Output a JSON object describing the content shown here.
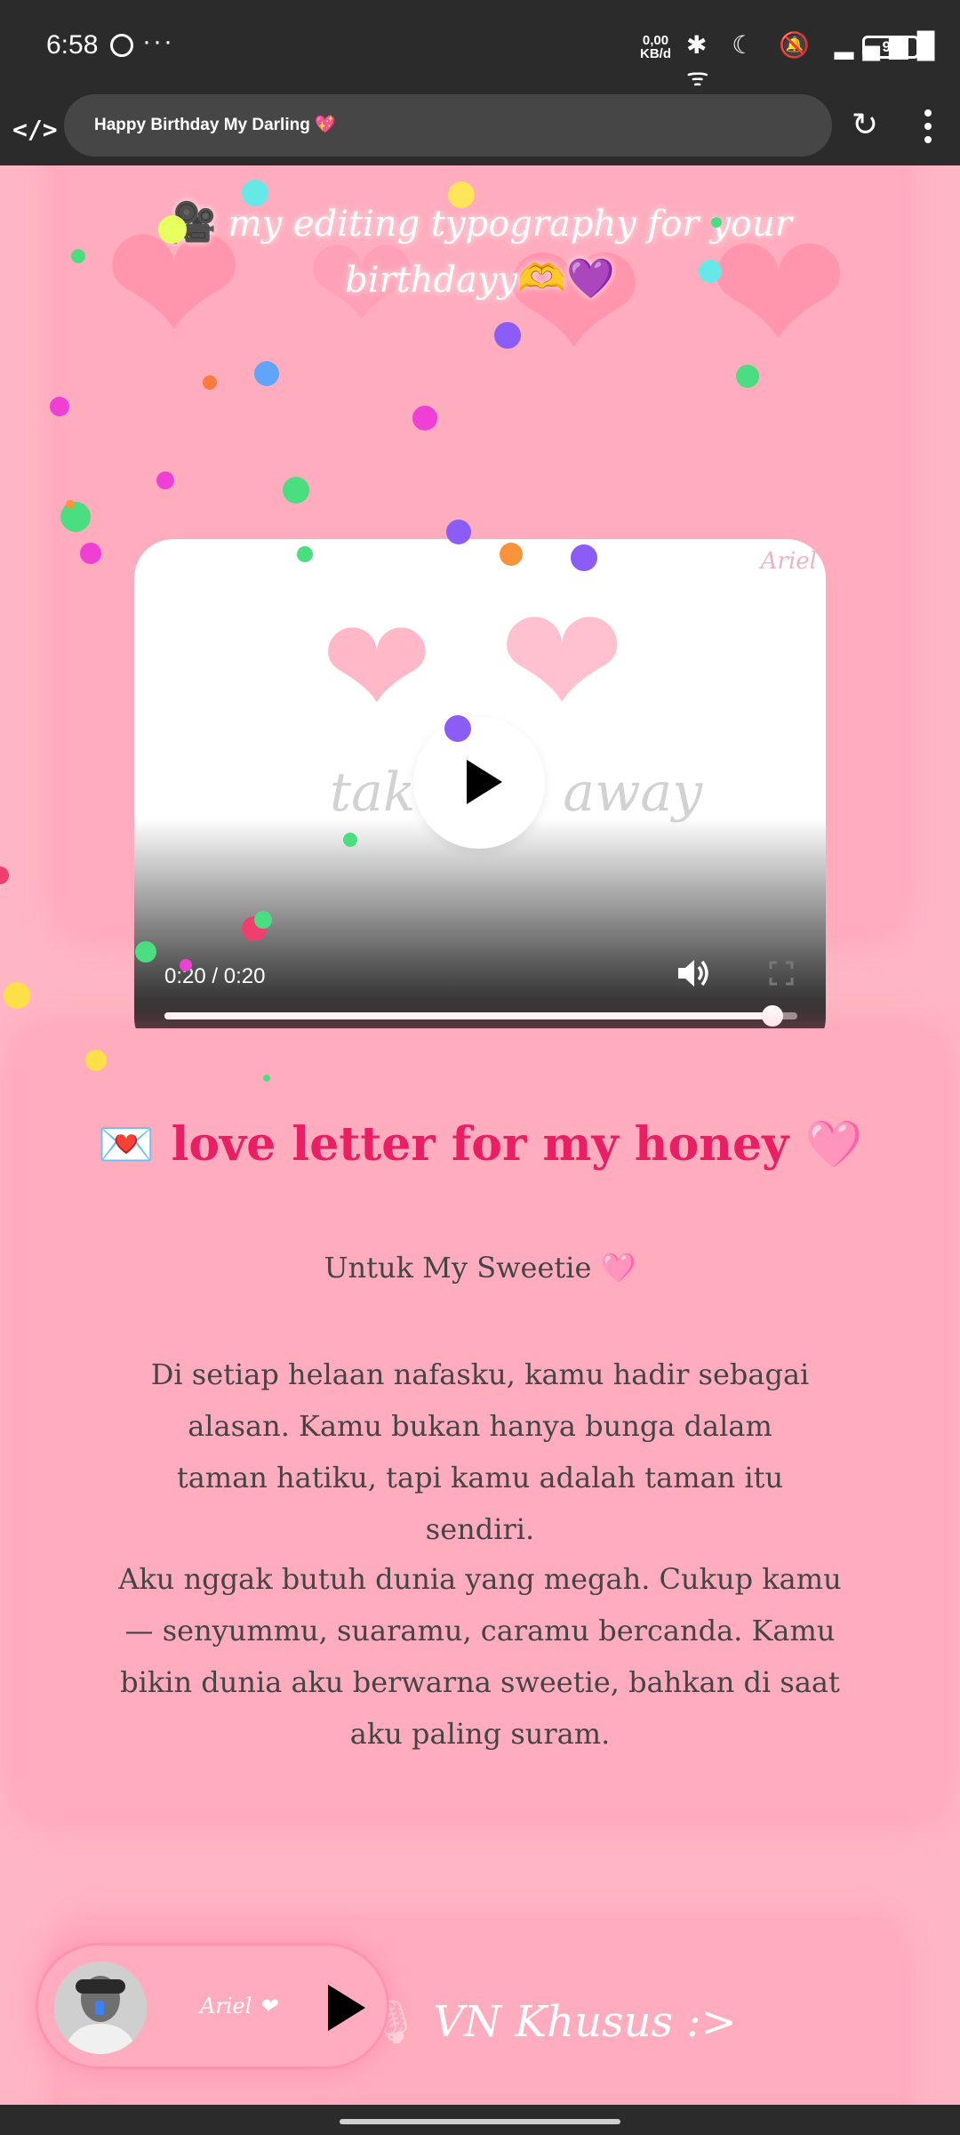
{
  "status_bar": {
    "time": "6:58",
    "dots": "···",
    "net_speed_value": "0,00",
    "net_speed_unit": "KB/d",
    "icons": "✱ ☾ 🔕 ▂▄▆█ ᯤ",
    "battery": "95"
  },
  "browser": {
    "title": "Happy Birthday My Darling 💖",
    "logo": "</>"
  },
  "video_section": {
    "title": "my editing typography for your birthdayy",
    "title_prefix_emoji": "🎥",
    "title_suffix_emoji": "🫶💜",
    "watermark": "take me away",
    "corner_mark": "Ariel",
    "time": "0:20 / 0:20",
    "progress": 0.96
  },
  "letter": {
    "title": "love letter for my honey",
    "title_prefix_emoji": "💌",
    "title_suffix_emoji": "🩷",
    "greeting": "Untuk My Sweetie 🩷",
    "paragraph_1": "Di setiap helaan nafasku, kamu hadir sebagai alasan. Kamu bukan hanya bunga dalam taman hatiku, tapi kamu adalah taman itu sendiri.",
    "paragraph_2": "Aku nggak butuh dunia yang megah. Cukup kamu — senyummu, suaramu, caramu bercanda. Kamu bikin dunia aku berwarna sweetie, bahkan di saat aku paling suram."
  },
  "vn_section": {
    "title": "VN Khusus :>",
    "mic_icon": "🎙"
  },
  "mini_player": {
    "label": "Ariel ❤"
  },
  "colors": {
    "background": "#ffb6c4",
    "card": "#ffadbe",
    "accent": "#e91e63",
    "system_bar": "#2b2b2b"
  }
}
